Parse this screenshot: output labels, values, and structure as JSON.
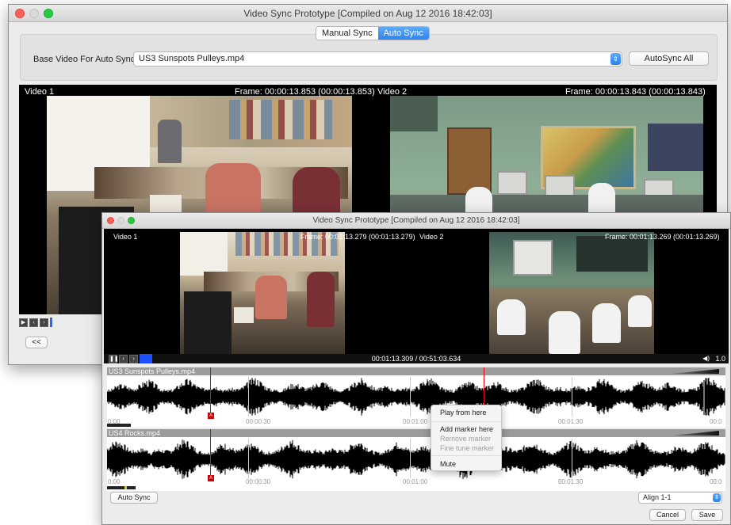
{
  "window1": {
    "title": "Video Sync Prototype [Compiled on Aug 12 2016 18:42:03]",
    "tabs": [
      {
        "label": "Manual Sync",
        "active": false
      },
      {
        "label": "Auto Sync",
        "active": true
      }
    ],
    "base_label": "Base Video For Auto Sync:",
    "base_value": "US3 Sunspots Pulleys.mp4",
    "autosync_all": "AutoSync All",
    "video1": {
      "label": "Video 1",
      "frame": "Frame: 00:00:13.853 (00:00:13.853)"
    },
    "video2": {
      "label": "Video 2",
      "frame": "Frame: 00:00:13.843 (00:00:13.843)"
    },
    "back_button": "<<",
    "controls": [
      "play-icon",
      "step-back-icon",
      "step-forward-icon"
    ]
  },
  "window2": {
    "title": "Video Sync Prototype [Compiled on Aug 12 2016 18:42:03]",
    "video1": {
      "label": "Video 1",
      "frame": "Frame: 00:01:13.279 (00:01:13.279)"
    },
    "video2": {
      "label": "Video 2",
      "frame": "Frame: 00:01:13.269 (00:01:13.269)"
    },
    "timecode": "00:01:13.309 / 00:51:03.634",
    "speed": "1.0",
    "controls": [
      "pause-icon",
      "step-back-icon",
      "step-forward-icon"
    ],
    "tracks": [
      {
        "name": "US3 Sunspots Pulleys.mp4",
        "ticks": [
          "0:00",
          "00:00:30",
          "00:01:00",
          "00:01:30",
          "00:0"
        ]
      },
      {
        "name": "US4 Rocks.mp4",
        "ticks": [
          "0:00",
          "00:00:30",
          "00:01:00",
          "00:01:30",
          "00:0"
        ]
      }
    ],
    "marker_letter": "A",
    "context_menu": {
      "play": "Play from here",
      "add": "Add marker here",
      "remove": "Remove marker",
      "fine": "Fine tune marker",
      "mute": "Mute"
    },
    "auto_sync": "Auto Sync",
    "align": "Align 1-1",
    "cancel": "Cancel",
    "save": "Save"
  }
}
